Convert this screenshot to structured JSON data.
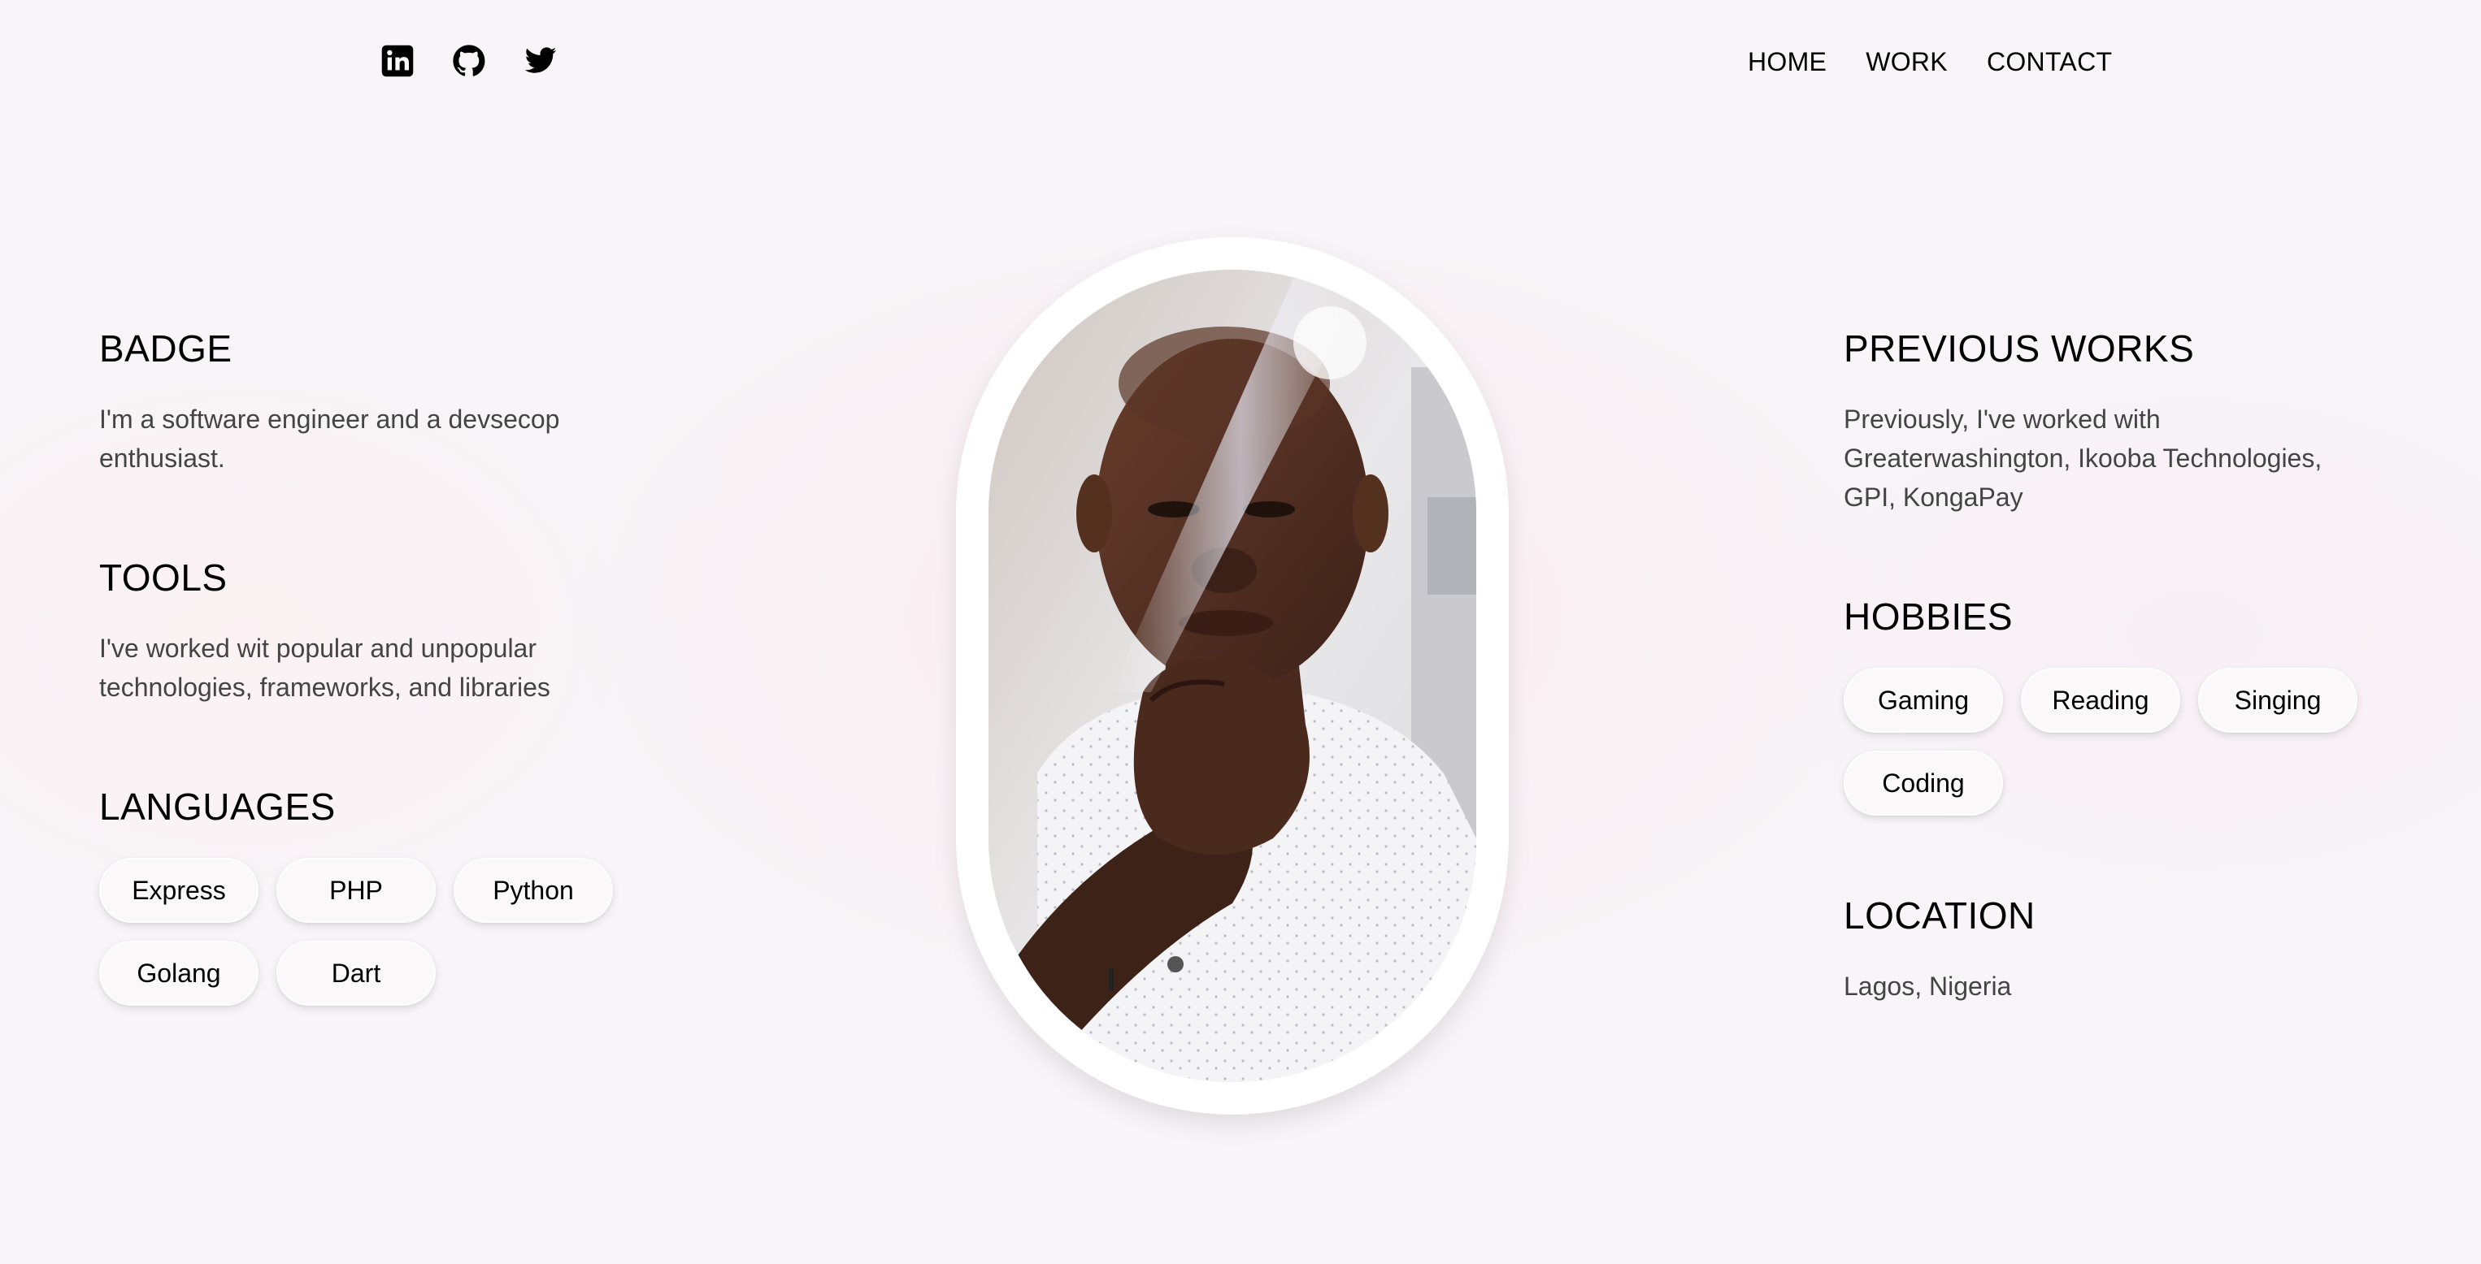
{
  "header": {
    "socials": [
      {
        "icon": "linkedin-icon"
      },
      {
        "icon": "github-icon"
      },
      {
        "icon": "twitter-icon"
      }
    ],
    "nav": [
      {
        "label": "HOME"
      },
      {
        "label": "WORK"
      },
      {
        "label": "CONTACT"
      }
    ]
  },
  "left": {
    "badge": {
      "title": "BADGE",
      "text": "I'm a software engineer and a devsecop enthusiast."
    },
    "tools": {
      "title": "TOOLS",
      "text": "I've worked wit popular and unpopular technologies, frameworks, and libraries"
    },
    "languages": {
      "title": "LANGUAGES",
      "items": [
        "Express",
        "PHP",
        "Python",
        "Golang",
        "Dart"
      ]
    }
  },
  "right": {
    "previous_works": {
      "title": "PREVIOUS WORKS",
      "text": "Previously, I've worked with Greaterwashington, Ikooba Technologies, GPI, KongaPay"
    },
    "hobbies": {
      "title": "HOBBIES",
      "items": [
        "Gaming",
        "Reading",
        "Singing",
        "Coding"
      ]
    },
    "location": {
      "title": "LOCATION",
      "text": "Lagos, Nigeria"
    }
  },
  "colors": {
    "background": "#f8f4f7",
    "text": "#000000",
    "body_text": "#444444",
    "chip_background": "#fbf8fa"
  }
}
